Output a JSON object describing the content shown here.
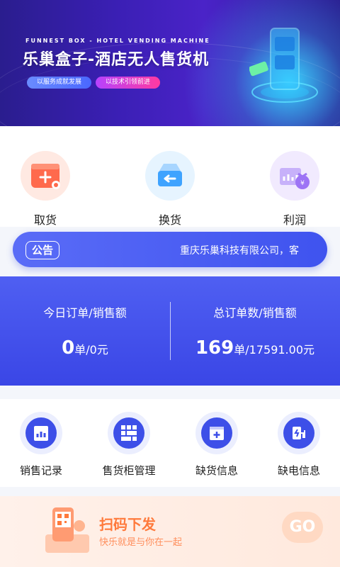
{
  "banner": {
    "subtitle": "FUNNEST BOX - HOTEL VENDING MACHINE",
    "title": "乐巢盒子-酒店无人售货机",
    "tags": [
      "以服务成就发展",
      "以技术引领前进"
    ]
  },
  "actions": [
    {
      "label": "取货",
      "icon": "box-plus-icon",
      "color": "#ff6a4d"
    },
    {
      "label": "换货",
      "icon": "tray-return-icon",
      "color": "#3fa3ff"
    },
    {
      "label": "利润",
      "icon": "money-bag-icon",
      "color": "#9d74f5"
    }
  ],
  "notice": {
    "badge": "公告",
    "text": "重庆乐巢科技有限公司，客"
  },
  "stats": {
    "today": {
      "title": "今日订单/销售额",
      "orders": "0",
      "unit": "单/",
      "amount": "0元"
    },
    "total": {
      "title": "总订单数/销售额",
      "orders": "169",
      "unit": "单/",
      "amount": "17591.00元"
    }
  },
  "grid": [
    {
      "label": "销售记录",
      "icon": "clipboard-chart-icon"
    },
    {
      "label": "售货柜管理",
      "icon": "cabinet-grid-icon"
    },
    {
      "label": "缺货信息",
      "icon": "box-add-icon"
    },
    {
      "label": "缺电信息",
      "icon": "charger-icon"
    }
  ],
  "scan": {
    "title": "扫码下发",
    "subtitle": "快乐就是与你在一起",
    "go": "GO"
  },
  "colors": {
    "primary": "#3d4fe8",
    "accent": "#ff7a3c"
  }
}
